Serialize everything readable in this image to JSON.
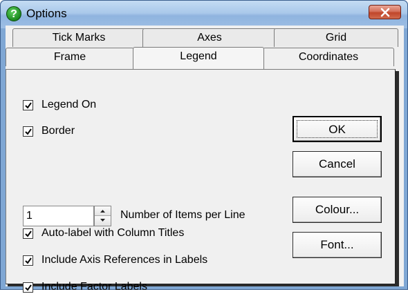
{
  "window": {
    "title": "Options",
    "app_icon": "question-mark-icon",
    "close_icon": "close-x-icon"
  },
  "tabs": {
    "back_row": [
      "Tick Marks",
      "Axes",
      "Grid"
    ],
    "front_row": [
      "Frame",
      "Legend",
      "Coordinates"
    ],
    "active": "Legend"
  },
  "legend": {
    "legend_on": {
      "label": "Legend On",
      "checked": true
    },
    "border": {
      "label": "Border",
      "checked": true
    },
    "items_per_line": {
      "value": "1",
      "label": "Number of Items per Line"
    },
    "auto_label": {
      "label": "Auto-label with Column Titles",
      "checked": true
    },
    "axis_refs": {
      "label": "Include Axis References in Labels",
      "checked": true
    },
    "factor_labels": {
      "label": "Include Factor Labels",
      "checked": true
    }
  },
  "buttons": {
    "ok": "OK",
    "cancel": "Cancel",
    "colour": "Colour...",
    "font": "Font..."
  },
  "colors": {
    "title_bar": "#a9c8ea",
    "close_button": "#c0462b",
    "face": "#f0f0f0"
  }
}
